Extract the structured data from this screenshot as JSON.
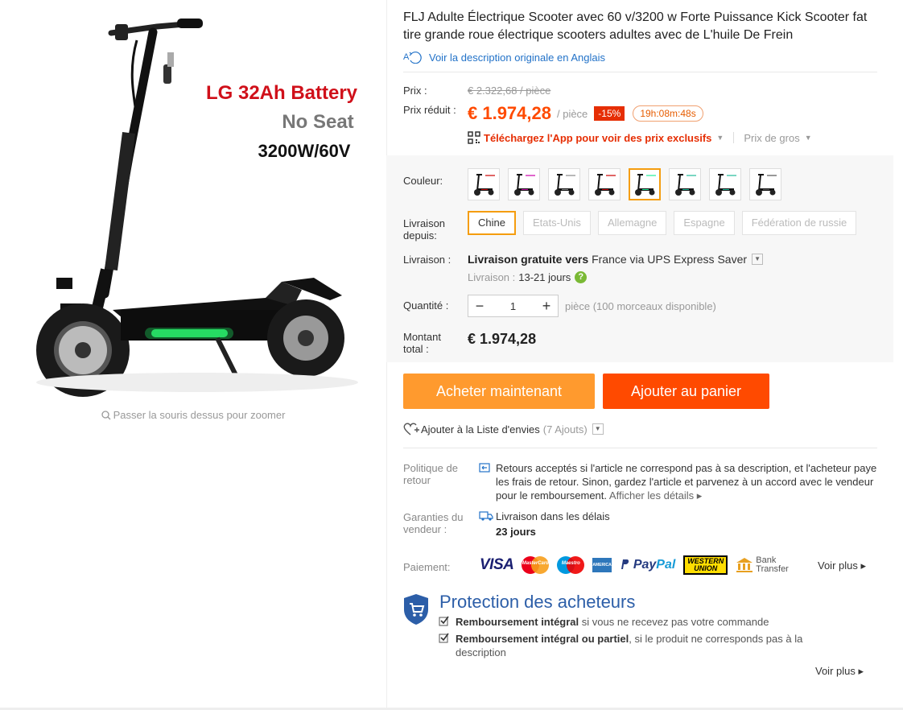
{
  "product": {
    "title": "FLJ Adulte Électrique Scooter avec 60 v/3200 w Forte Puissance Kick Scooter fat tire grande roue électrique scooters adultes avec de L'huile De Frein",
    "translate_link": "Voir la description originale en Anglais"
  },
  "image": {
    "line1": "LG 32Ah Battery",
    "line2": "No Seat",
    "line3": "3200W/60V",
    "zoom_hint": "Passer la souris dessus pour zoomer"
  },
  "price": {
    "label": "Prix :",
    "original": "€ 2.322,68 / pièce",
    "reduced_label": "Prix réduit :",
    "reduced": "€ 1.974,28",
    "unit": "/ pièce",
    "discount": "-15%",
    "countdown": "19h:08m:48s",
    "app_link": "Téléchargez l'App pour voir des prix exclusifs",
    "bulk": "Prix de gros"
  },
  "options": {
    "color_label": "Couleur:",
    "colors_count": 8,
    "selected_color_index": 4,
    "ship_from_label": "Livraison depuis:",
    "ship_from": [
      "Chine",
      "Etats-Unis",
      "Allemagne",
      "Espagne",
      "Fédération de russie"
    ],
    "shipping_label": "Livraison :",
    "shipping_bold": "Livraison gratuite vers",
    "shipping_rest": "France via UPS Express Saver",
    "delivery_label": "Livraison :",
    "delivery_days": "13-21 jours",
    "qty_label": "Quantité :",
    "qty_value": "1",
    "qty_note": "pièce (100 morceaux disponible)",
    "total_label": "Montant total :",
    "total": "€ 1.974,28"
  },
  "actions": {
    "buy_now": "Acheter maintenant",
    "add_to_cart": "Ajouter au panier",
    "wishlist": "Ajouter à la Liste d'envies",
    "wishlist_count": "(7 Ajouts)"
  },
  "policy": {
    "return_label": "Politique de retour",
    "return_text": "Retours acceptés si l'article ne correspond pas à sa description, et l'acheteur paye les frais de retour. Sinon, gardez l'article et parvenez à un accord avec le vendeur pour le remboursement.",
    "details_link": "Afficher les détails",
    "guarantee_label": "Garanties du vendeur :",
    "guarantee_text": "Livraison dans les délais",
    "guarantee_days": "23 jours"
  },
  "payment": {
    "label": "Paiement:",
    "visa": "VISA",
    "mastercard": "MasterCard",
    "maestro": "Maestro",
    "amex": "AMERICAN EXPRESS",
    "paypal_a": "Pay",
    "paypal_b": "Pal",
    "wu_1": "WESTERN",
    "wu_2": "UNION",
    "bank_1": "Bank",
    "bank_2": "Transfer",
    "more": "Voir plus"
  },
  "protection": {
    "title": "Protection des acheteurs",
    "item1_bold": "Remboursement intégral",
    "item1_rest": "si vous ne recevez pas votre commande",
    "item2_bold": "Remboursement intégral ou partiel",
    "item2_rest": ", si le produit ne corresponds pas à la description",
    "more": "Voir plus"
  },
  "colors": {
    "accent_orange": "#ff9a2e",
    "accent_red": "#ff4a00",
    "price": "#ff4a00",
    "link_blue": "#2272c8",
    "selected_border": "#f59d0f"
  }
}
